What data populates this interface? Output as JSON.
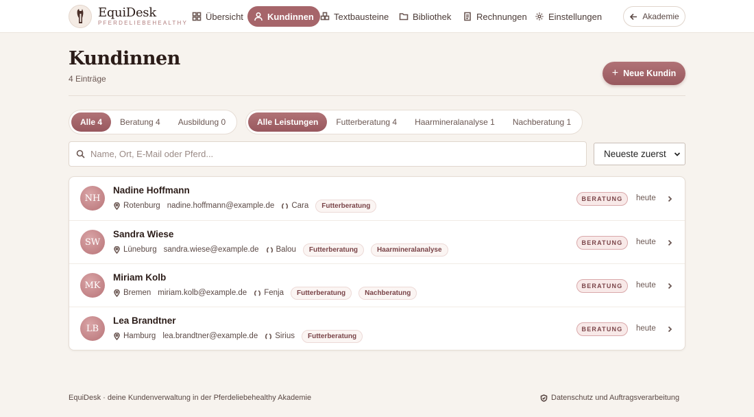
{
  "header": {
    "brand_name": "EquiDesk",
    "brand_tagline": "PFERDELIEBEHEALTHY",
    "nav": [
      {
        "label": "Übersicht",
        "icon": "grid-icon",
        "active": false
      },
      {
        "label": "Kundinnen",
        "icon": "users-icon",
        "active": true
      },
      {
        "label": "Textbausteine",
        "icon": "blocks-icon",
        "active": false
      },
      {
        "label": "Bibliothek",
        "icon": "folder-icon",
        "active": false
      },
      {
        "label": "Rechnungen",
        "icon": "document-icon",
        "active": false
      },
      {
        "label": "Einstellungen",
        "icon": "gear-icon",
        "active": false
      }
    ],
    "back_label": "Akademie"
  },
  "main": {
    "title": "Kundinnen",
    "entry_count": "4 Einträge",
    "new_button_label": "Neue Kundin",
    "type_filters": [
      {
        "label": "Alle 4",
        "active": true
      },
      {
        "label": "Beratung 4",
        "active": false
      },
      {
        "label": "Ausbildung 0",
        "active": false
      }
    ],
    "service_filters": [
      {
        "label": "Alle Leistungen",
        "active": true
      },
      {
        "label": "Futterberatung 4",
        "active": false
      },
      {
        "label": "Haarmineralanalyse 1",
        "active": false
      },
      {
        "label": "Nachberatung 1",
        "active": false
      }
    ],
    "search": {
      "placeholder": "Name, Ort, E-Mail oder Pferd...",
      "value": ""
    },
    "sort": {
      "selected": "Neueste zuerst"
    }
  },
  "customers": [
    {
      "initials": "NH",
      "name": "Nadine Hoffmann",
      "city": "Rotenburg",
      "email": "nadine.hoffmann@example.de",
      "horse": "Cara",
      "tags": [
        "Futterberatung"
      ],
      "status": "BERATUNG",
      "updated": "heute"
    },
    {
      "initials": "SW",
      "name": "Sandra Wiese",
      "city": "Lüneburg",
      "email": "sandra.wiese@example.de",
      "horse": "Balou",
      "tags": [
        "Futterberatung",
        "Haarmineralanalyse"
      ],
      "status": "BERATUNG",
      "updated": "heute"
    },
    {
      "initials": "MK",
      "name": "Miriam Kolb",
      "city": "Bremen",
      "email": "miriam.kolb@example.de",
      "horse": "Fenja",
      "tags": [
        "Futterberatung",
        "Nachberatung"
      ],
      "status": "BERATUNG",
      "updated": "heute"
    },
    {
      "initials": "LB",
      "name": "Lea Brandtner",
      "city": "Hamburg",
      "email": "lea.brandtner@example.de",
      "horse": "Sirius",
      "tags": [
        "Futterberatung"
      ],
      "status": "BERATUNG",
      "updated": "heute"
    }
  ],
  "footer": {
    "left": "EquiDesk · deine Kundenverwaltung in der Pferdeliebehealthy Akademie",
    "right": "Datenschutz und Auftragsverarbeitung"
  },
  "colors": {
    "accent": "#a6656a",
    "background": "#f7f3ee",
    "badge_bg": "#f8e9e8"
  }
}
